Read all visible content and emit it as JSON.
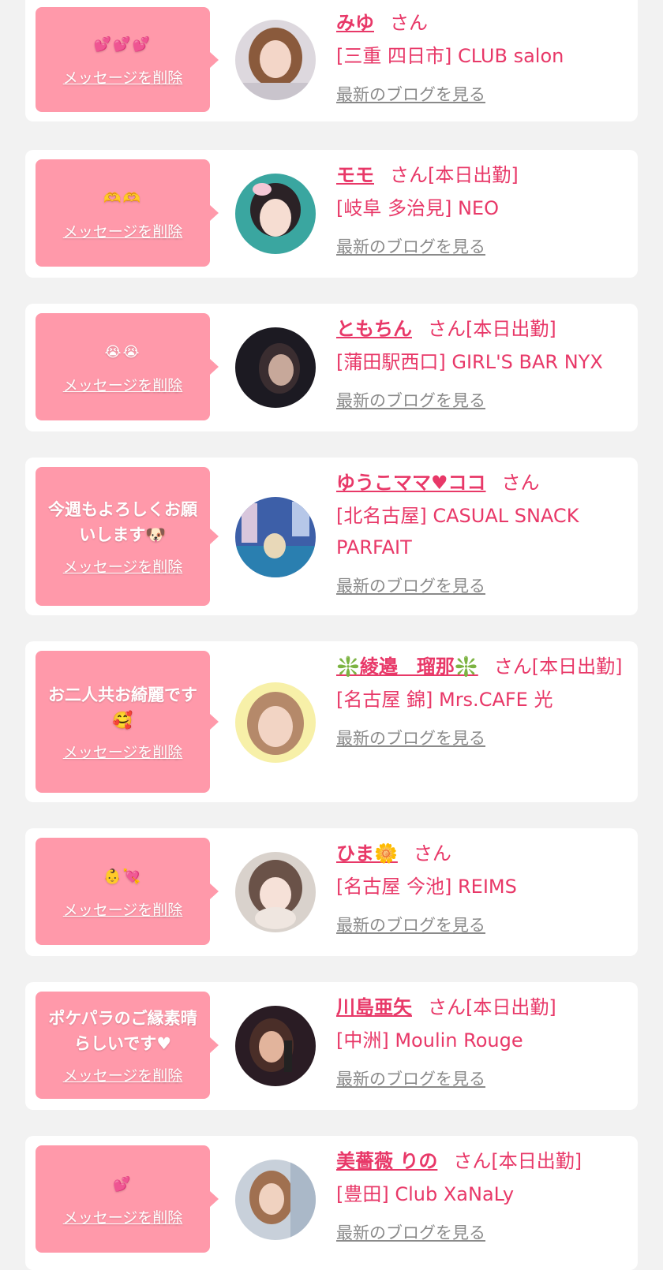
{
  "delete_label": "メッセージを削除",
  "blog_label": "最新のブログを見る",
  "cards": [
    {
      "message": "💕💕💕",
      "name": "みゆ",
      "suffix": "さん",
      "shop": "[三重 四日市] CLUB salon"
    },
    {
      "message": "🫶🫶",
      "name": "モモ",
      "suffix": "さん[本日出勤]",
      "shop": "[岐阜 多治見] NEO"
    },
    {
      "message": "😭😭",
      "name": "ともちん",
      "suffix": "さん[本日出勤]",
      "shop": "[蒲田駅西口] GIRL'S BAR NYX"
    },
    {
      "message": "今週もよろしくお願いします🐶",
      "name": "ゆうこママ♥ココ",
      "suffix": "さん",
      "shop": "[北名古屋] CASUAL SNACK PARFAIT"
    },
    {
      "message": "お二人共お綺麗です🥰",
      "name": "❇️綾邉　瑠那❇️",
      "suffix": "さん[本日出勤]",
      "shop": "[名古屋 錦] Mrs.CAFE 光"
    },
    {
      "message": "👶💘",
      "name": "ひま🌼",
      "suffix": "さん",
      "shop": "[名古屋 今池] REIMS"
    },
    {
      "message": "ポケパラのご縁素晴らしいです♥",
      "name": "川島亜矢",
      "suffix": "さん[本日出勤]",
      "shop": "[中洲] Moulin Rouge"
    },
    {
      "message": "💕",
      "name": "美薔薇 りの",
      "suffix": "さん[本日出勤]",
      "shop": "[豊田] Club XaNaLy"
    }
  ]
}
